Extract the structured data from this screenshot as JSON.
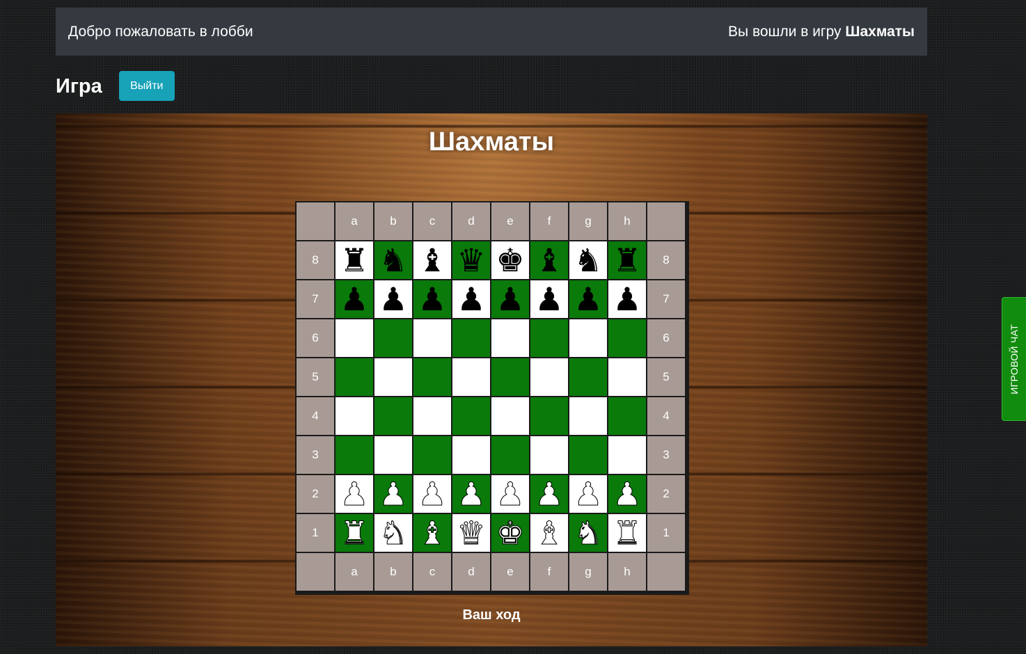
{
  "topbar": {
    "welcome": "Добро пожаловать в лобби",
    "logged_prefix": "Вы вошли в игру ",
    "game_name": "Шахматы"
  },
  "game_header": {
    "title": "Игра",
    "exit_label": "Выйти"
  },
  "panel": {
    "title": "Шахматы",
    "status": "Ваш ход"
  },
  "board": {
    "files": [
      "a",
      "b",
      "c",
      "d",
      "e",
      "f",
      "g",
      "h"
    ],
    "ranks": [
      "8",
      "7",
      "6",
      "5",
      "4",
      "3",
      "2",
      "1"
    ],
    "rows": [
      [
        "br",
        "bn",
        "bb",
        "bq",
        "bk",
        "bb",
        "bn",
        "br"
      ],
      [
        "bp",
        "bp",
        "bp",
        "bp",
        "bp",
        "bp",
        "bp",
        "bp"
      ],
      [
        "",
        "",
        "",
        "",
        "",
        "",
        "",
        ""
      ],
      [
        "",
        "",
        "",
        "",
        "",
        "",
        "",
        ""
      ],
      [
        "",
        "",
        "",
        "",
        "",
        "",
        "",
        ""
      ],
      [
        "",
        "",
        "",
        "",
        "",
        "",
        "",
        ""
      ],
      [
        "wp",
        "wp",
        "wp",
        "wp",
        "wp",
        "wp",
        "wp",
        "wp"
      ],
      [
        "wr",
        "wn",
        "wb",
        "wq",
        "wk",
        "wb",
        "wn",
        "wr"
      ]
    ],
    "colors": {
      "light": "#ffffff",
      "dark": "#0a7a0a",
      "coord_bg": "#a89b95"
    }
  },
  "chat_tab": {
    "label": "ИГРОВОЙ ЧАТ"
  }
}
